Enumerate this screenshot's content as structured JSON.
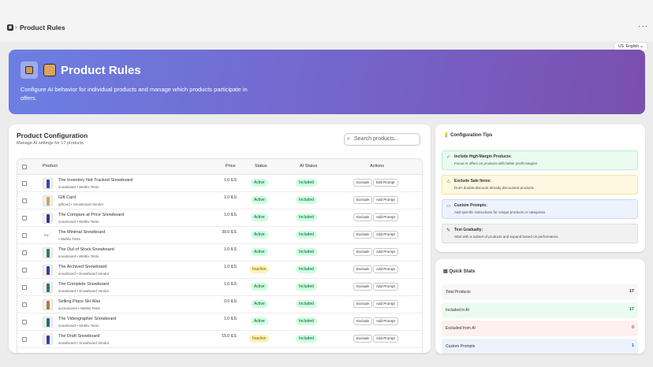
{
  "topbar": {
    "app_icon": "app-icon",
    "separator": "›",
    "title": "Product Rules",
    "more": "···"
  },
  "language": {
    "flag": "US",
    "label": "English"
  },
  "hero": {
    "title": "Product Rules",
    "description": "Configure AI behavior for individual products and manage which products participate in offers."
  },
  "config": {
    "title": "Product Configuration",
    "subtitle": "Manage AI settings for 17 products",
    "search_placeholder": "Search products...",
    "columns": [
      "Product",
      "Price",
      "Status",
      "AI Status",
      "Actions"
    ]
  },
  "products": [
    {
      "name": "The Inventory Not Tracked Snowboard",
      "meta": "snowboard • Weblix Tests",
      "price": "1.0 ILS",
      "status": "Active",
      "ai": "Included",
      "btn1": "Exclude",
      "btn2": "Edit Prompt",
      "thumb_color": "#3b46a8"
    },
    {
      "name": "Gift Card",
      "meta": "giftcard • Snowboard Vendor",
      "price": "1.0 ILS",
      "status": "Active",
      "ai": "Included",
      "btn1": "Exclude",
      "btn2": "Add Prompt",
      "thumb_color": "#c9a46a"
    },
    {
      "name": "The Compare at Price Snowboard",
      "meta": "snowboard • Weblix Tests",
      "price": "1.0 ILS",
      "status": "Active",
      "ai": "Included",
      "btn1": "Exclude",
      "btn2": "Add Prompt",
      "thumb_color": "#2e3a8c"
    },
    {
      "name": "The Minimal Snowboard",
      "meta": "• Weblix Tests",
      "price": "30.0 ILS",
      "status": "Active",
      "ai": "Included",
      "btn1": "Exclude",
      "btn2": "Add Prompt",
      "thumb_color": "#d9d9d9",
      "thumb_text": "The"
    },
    {
      "name": "The Out of Stock Snowboard",
      "meta": "snowboard • Weblix Tests",
      "price": "1.0 ILS",
      "status": "Active",
      "ai": "Included",
      "btn1": "Exclude",
      "btn2": "Add Prompt",
      "thumb_color": "#2f7d6a"
    },
    {
      "name": "The Archived Snowboard",
      "meta": "snowboard • Snowboard Vendor",
      "price": "1.0 ILS",
      "status": "Inactive",
      "ai": "Included",
      "btn1": "Exclude",
      "btn2": "Add Prompt",
      "thumb_color": "#3a3fa0"
    },
    {
      "name": "The Complete Snowboard",
      "meta": "snowboard • Snowboard Vendor",
      "price": "1.0 ILS",
      "status": "Active",
      "ai": "Included",
      "btn1": "Exclude",
      "btn2": "Add Prompt",
      "thumb_color": "#2d7a5a"
    },
    {
      "name": "Selling Plans Ski Wax",
      "meta": "accessories • Weblix Tests",
      "price": "0.0 ILS",
      "status": "Active",
      "ai": "Included",
      "btn1": "Exclude",
      "btn2": "Add Prompt",
      "thumb_color": "#b07a3a"
    },
    {
      "name": "The Videographer Snowboard",
      "meta": "snowboard • Weblix Tests",
      "price": "1.0 ILS",
      "status": "Active",
      "ai": "Included",
      "btn1": "Exclude",
      "btn2": "Add Prompt",
      "thumb_color": "#1f6f7a"
    },
    {
      "name": "The Draft Snowboard",
      "meta": "snowboard • Snowboard Vendor",
      "price": "15.0 ILS",
      "status": "Inactive",
      "ai": "Included",
      "btn1": "Exclude",
      "btn2": "Add Prompt",
      "thumb_color": "#3441a0"
    }
  ],
  "tips": {
    "title": "Configuration Tips",
    "items": [
      {
        "icon": "check-icon",
        "glyph": "✓",
        "title": "Include High-Margin Products:",
        "desc": "Focus AI offers on products with better profit margins",
        "bg": "#eafbef",
        "border": "#b9eccb",
        "icon_color": "#1a7f4b"
      },
      {
        "icon": "warning-icon",
        "glyph": "⚠",
        "title": "Exclude Sale Items:",
        "desc": "Don't double-discount already discounted products",
        "bg": "#fff8e1",
        "border": "#f6e3a1",
        "icon_color": "#b27c00"
      },
      {
        "icon": "chat-icon",
        "glyph": "▭",
        "title": "Custom Prompts:",
        "desc": "Add specific instructions for unique products or categories",
        "bg": "#edf3fc",
        "border": "#c9d9f2",
        "icon_color": "#4a5a7a"
      },
      {
        "icon": "test-icon",
        "glyph": "✎",
        "title": "Test Gradually:",
        "desc": "Start with a subset of products and expand based on performance",
        "bg": "#f1f1f1",
        "border": "#dcdcdc",
        "icon_color": "#303030"
      }
    ]
  },
  "stats": {
    "title": "Quick Stats",
    "items": [
      {
        "label": "Total Products",
        "value": "17",
        "bg": "#f7f7f7",
        "color": "#303030"
      },
      {
        "label": "Included in AI",
        "value": "17",
        "bg": "#ecfbf1",
        "color": "#1a7f4b"
      },
      {
        "label": "Excluded from AI",
        "value": "0",
        "bg": "#fdf0ee",
        "color": "#c0392b"
      },
      {
        "label": "Custom Prompts",
        "value": "1",
        "bg": "#edf3fc",
        "color": "#2c5aa0"
      }
    ]
  }
}
